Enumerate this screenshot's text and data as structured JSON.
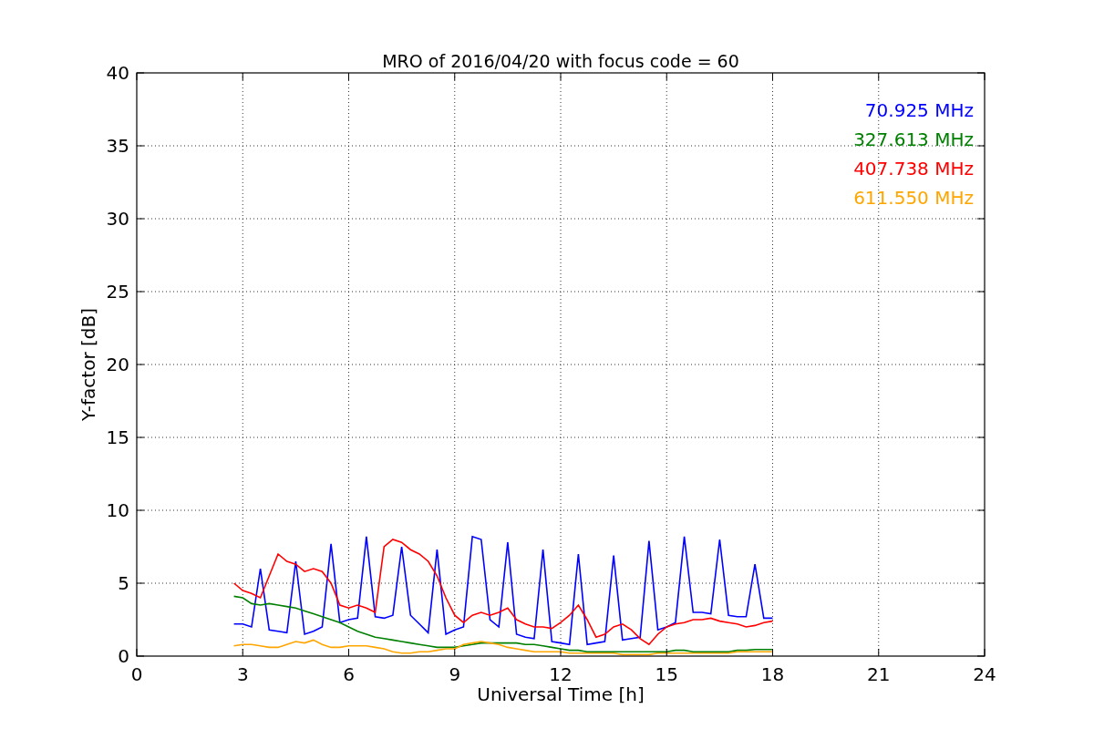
{
  "chart_data": {
    "type": "line",
    "title": "MRO of 2016/04/20 with focus code = 60",
    "xlabel": "Universal Time [h]",
    "ylabel": "Y-factor [dB]",
    "x": [
      2.75,
      3,
      3.25,
      3.5,
      3.75,
      4,
      4.25,
      4.5,
      4.75,
      5,
      5.25,
      5.5,
      5.75,
      6,
      6.25,
      6.5,
      6.75,
      7,
      7.25,
      7.5,
      7.75,
      8,
      8.25,
      8.5,
      8.75,
      9,
      9.25,
      9.5,
      9.75,
      10,
      10.25,
      10.5,
      10.75,
      11,
      11.25,
      11.5,
      11.75,
      12,
      12.25,
      12.5,
      12.75,
      13,
      13.25,
      13.5,
      13.75,
      14,
      14.25,
      14.5,
      14.75,
      15,
      15.25,
      15.5,
      15.75,
      16,
      16.25,
      16.5,
      16.75,
      17,
      17.25,
      17.5,
      17.75,
      18
    ],
    "series": [
      {
        "name": "70.925 MHz",
        "color": "#0000ff",
        "values": [
          2.2,
          2.2,
          2.0,
          6.0,
          1.8,
          1.7,
          1.6,
          6.5,
          1.5,
          1.7,
          2.0,
          7.7,
          2.3,
          2.5,
          2.6,
          8.2,
          2.7,
          2.6,
          2.8,
          7.5,
          2.8,
          2.2,
          1.6,
          7.3,
          1.5,
          1.8,
          2.0,
          8.2,
          8.0,
          2.5,
          2.0,
          7.8,
          1.5,
          1.3,
          1.2,
          7.3,
          1.0,
          0.9,
          0.8,
          7.0,
          0.8,
          0.9,
          1.0,
          6.9,
          1.1,
          1.2,
          1.3,
          7.9,
          1.8,
          2.0,
          2.3,
          8.2,
          3.0,
          3.0,
          2.9,
          8.0,
          2.8,
          2.7,
          2.7,
          6.3,
          2.6,
          2.6
        ]
      },
      {
        "name": "327.613 MHz",
        "color": "#008000",
        "values": [
          4.1,
          4.0,
          3.6,
          3.5,
          3.6,
          3.5,
          3.4,
          3.3,
          3.1,
          2.9,
          2.7,
          2.5,
          2.3,
          2.0,
          1.7,
          1.5,
          1.3,
          1.2,
          1.1,
          1.0,
          0.9,
          0.8,
          0.7,
          0.6,
          0.6,
          0.6,
          0.7,
          0.8,
          0.9,
          0.9,
          0.9,
          0.9,
          0.9,
          0.8,
          0.8,
          0.7,
          0.6,
          0.5,
          0.4,
          0.4,
          0.3,
          0.3,
          0.3,
          0.3,
          0.3,
          0.3,
          0.3,
          0.3,
          0.3,
          0.3,
          0.4,
          0.4,
          0.3,
          0.3,
          0.3,
          0.3,
          0.3,
          0.4,
          0.4,
          0.45,
          0.45,
          0.45
        ]
      },
      {
        "name": "407.738 MHz",
        "color": "#ff0000",
        "values": [
          5.0,
          4.5,
          4.3,
          4.0,
          5.5,
          7.0,
          6.5,
          6.3,
          5.8,
          6.0,
          5.8,
          5.0,
          3.5,
          3.3,
          3.5,
          3.3,
          3.0,
          7.5,
          8.0,
          7.8,
          7.3,
          7.0,
          6.5,
          5.5,
          4.0,
          2.8,
          2.3,
          2.8,
          3.0,
          2.8,
          3.0,
          3.3,
          2.5,
          2.2,
          2.0,
          2.0,
          1.9,
          2.3,
          2.8,
          3.5,
          2.5,
          1.3,
          1.5,
          2.0,
          2.2,
          1.8,
          1.2,
          0.8,
          1.5,
          2.0,
          2.2,
          2.3,
          2.5,
          2.5,
          2.6,
          2.4,
          2.3,
          2.2,
          2.0,
          2.1,
          2.3,
          2.4
        ]
      },
      {
        "name": "611.550 MHz",
        "color": "#ffa500",
        "values": [
          0.7,
          0.8,
          0.8,
          0.7,
          0.6,
          0.6,
          0.8,
          1.0,
          0.9,
          1.1,
          0.8,
          0.6,
          0.6,
          0.7,
          0.7,
          0.7,
          0.6,
          0.5,
          0.3,
          0.2,
          0.2,
          0.3,
          0.3,
          0.4,
          0.5,
          0.5,
          0.8,
          0.9,
          1.0,
          0.9,
          0.8,
          0.6,
          0.5,
          0.4,
          0.3,
          0.3,
          0.3,
          0.3,
          0.2,
          0.2,
          0.2,
          0.2,
          0.2,
          0.2,
          0.1,
          0.1,
          0.1,
          0.1,
          0.2,
          0.2,
          0.2,
          0.2,
          0.2,
          0.2,
          0.2,
          0.2,
          0.2,
          0.3,
          0.3,
          0.3,
          0.3,
          0.3
        ]
      }
    ],
    "grid": true,
    "xlim": [
      0,
      24
    ],
    "ylim": [
      0,
      40
    ],
    "xticks": [
      0,
      3,
      6,
      9,
      12,
      15,
      18,
      21,
      24
    ],
    "yticks": [
      0,
      5,
      10,
      15,
      20,
      25,
      30,
      35,
      40
    ]
  }
}
